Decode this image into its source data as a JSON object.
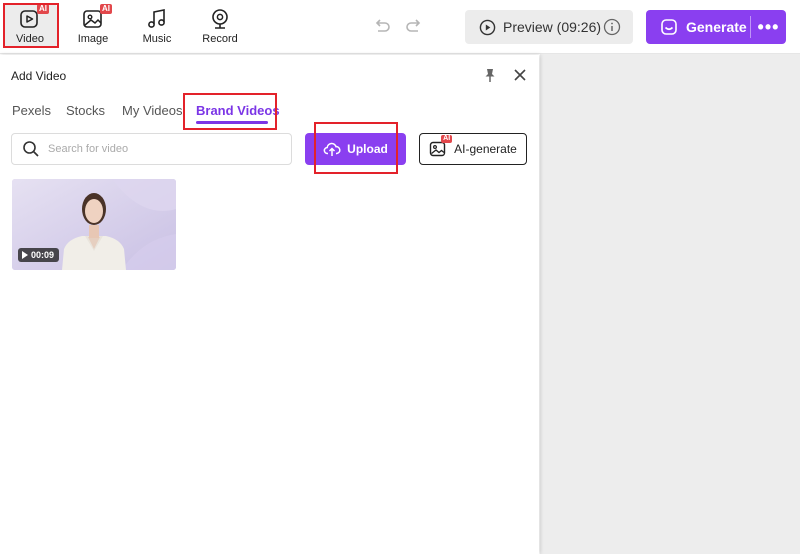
{
  "toolbar": {
    "tools": [
      {
        "label": "Video",
        "icon": "video-play-icon",
        "badge": "AI"
      },
      {
        "label": "Image",
        "icon": "image-icon",
        "badge": "AI"
      },
      {
        "label": "Music",
        "icon": "music-note-icon"
      },
      {
        "label": "Record",
        "icon": "webcam-icon"
      }
    ],
    "undo_icon": "undo-icon",
    "redo_icon": "redo-icon",
    "preview_label": "Preview (09:26)",
    "generate_label": "Generate",
    "more_label": "•••"
  },
  "panel": {
    "title": "Add Video",
    "tabs": [
      "Pexels",
      "Stocks",
      "My Videos",
      "Brand Videos"
    ],
    "active_tab": "Brand Videos",
    "search_placeholder": "Search for video",
    "upload_label": "Upload",
    "ai_generate_label": "AI-generate",
    "ai_badge": "AI",
    "videos": [
      {
        "duration": "00:09"
      }
    ]
  },
  "colors": {
    "accent": "#8a3ff0",
    "active_tab": "#7b35e6",
    "highlight_box": "#e3222a",
    "ai_badge": "#e2474b"
  }
}
